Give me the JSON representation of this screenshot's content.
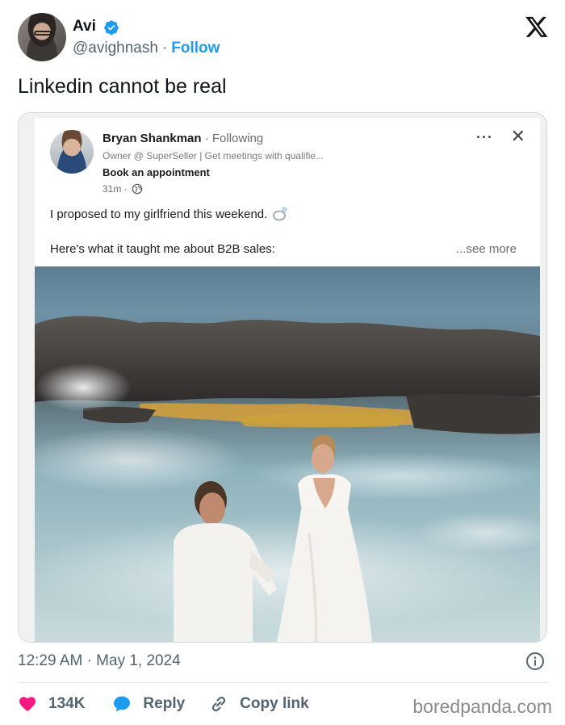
{
  "tweet": {
    "author_name": "Avi",
    "handle": "@avighnash",
    "separator": "·",
    "follow_label": "Follow",
    "text": "Linkedin cannot be real",
    "time": "12:29 AM",
    "date": "May 1, 2024",
    "time_date_separator": "·"
  },
  "linkedin_post": {
    "author_name": "Bryan Shankman",
    "following_label": "· Following",
    "headline": "Owner @ SuperSeller | Get meetings with qualifie...",
    "cta": "Book an appointment",
    "age": "31m ·",
    "line1": "I proposed to my girlfriend this weekend.",
    "line2": "Here's what it taught me about B2B sales:",
    "see_more": "...see more"
  },
  "actions": {
    "likes_count": "134K",
    "reply_label": "Reply",
    "copy_link_label": "Copy link"
  },
  "watermark": "boredpanda.com",
  "colors": {
    "accent_blue": "#1d9bf0",
    "like_pink": "#f91880",
    "muted_text": "#536471"
  },
  "icons": [
    "verified-badge-icon",
    "x-logo-icon",
    "ellipsis-icon",
    "close-icon",
    "globe-icon",
    "ring-emoji-icon",
    "info-icon",
    "heart-icon",
    "reply-bubble-icon",
    "link-icon"
  ]
}
